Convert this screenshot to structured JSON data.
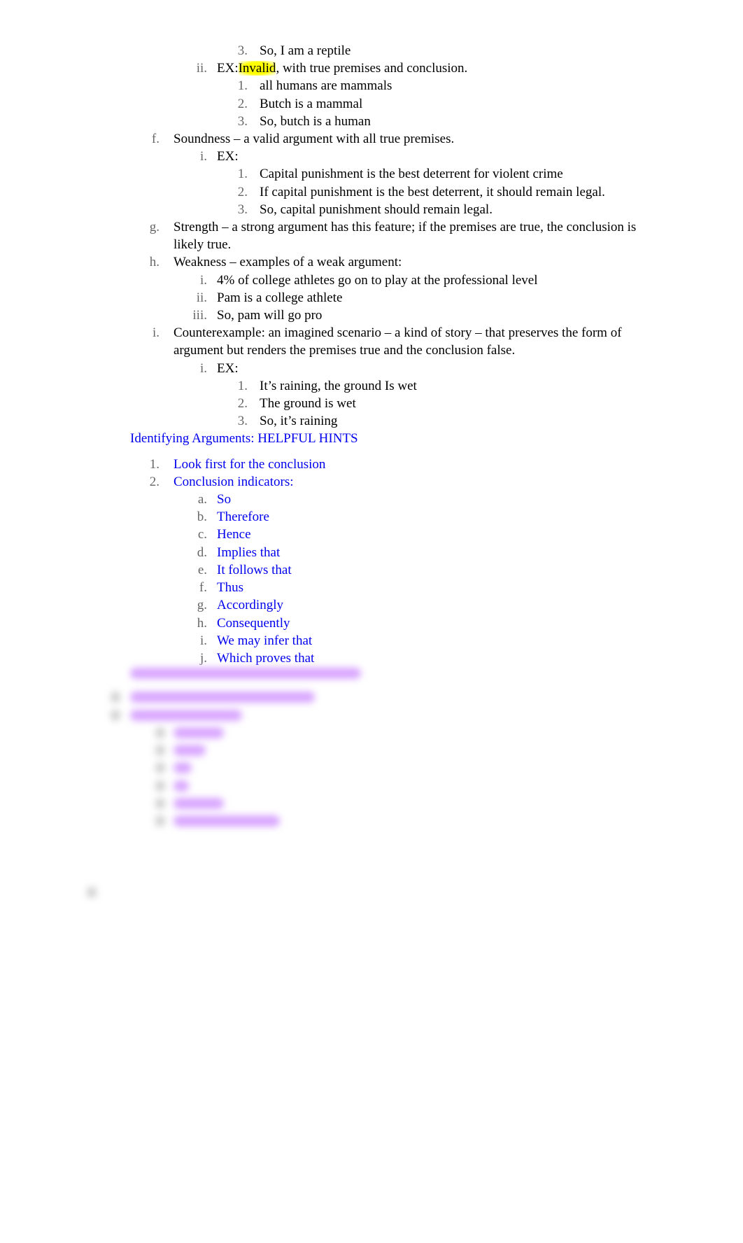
{
  "document": {
    "lines": [
      {
        "level": 4,
        "marker": "3.",
        "text": "So, I am a reptile"
      },
      {
        "level": 3,
        "marker": "ii.",
        "prefix": "EX:",
        "highlight": "Invalid",
        "text": ", with true premises and conclusion."
      },
      {
        "level": 4,
        "marker": "1.",
        "text": "all humans are mammals"
      },
      {
        "level": 4,
        "marker": "2.",
        "text": "Butch is a mammal"
      },
      {
        "level": 4,
        "marker": "3.",
        "text": "So, butch is a human"
      },
      {
        "level": 2,
        "marker": "f.",
        "text": "Soundness –  a valid argument with all true premises."
      },
      {
        "level": 3,
        "marker": "i.",
        "text": "EX:"
      },
      {
        "level": 4,
        "marker": "1.",
        "text": "Capital punishment is the best deterrent for violent crime"
      },
      {
        "level": 4,
        "marker": "2.",
        "text": "If capital punishment is the best deterrent, it should remain legal."
      },
      {
        "level": 4,
        "marker": "3.",
        "text": "So, capital punishment should remain legal."
      },
      {
        "level": 2,
        "marker": "g.",
        "text": "Strength –  a strong argument has this feature; if the premises are true, the conclusion is likely true."
      },
      {
        "level": 2,
        "marker": "h.",
        "text": "Weakness –  examples of a weak argument:"
      },
      {
        "level": 3,
        "marker": "i.",
        "text": "4% of college athletes go on to play at the professional level"
      },
      {
        "level": 3,
        "marker": "ii.",
        "text": "Pam is a college athlete"
      },
      {
        "level": 3,
        "marker": "iii.",
        "text": "So, pam will go pro"
      },
      {
        "level": 2,
        "marker": "i.",
        "text": "Counterexample:  an imagined scenario – a kind of story – that preserves the form of argument but renders the premises true and the conclusion false."
      },
      {
        "level": 3,
        "marker": "i.",
        "text": "EX:"
      },
      {
        "level": 4,
        "marker": "1.",
        "text": "It’s raining, the ground Is wet"
      },
      {
        "level": 4,
        "marker": "2.",
        "text": "The ground is wet"
      },
      {
        "level": 4,
        "marker": "3.",
        "text": "So, it’s raining"
      },
      {
        "level": 1,
        "marker": "",
        "text": "Identifying Arguments: HELPFUL HINTS",
        "color": "blue"
      },
      {
        "gap": true
      },
      {
        "level": 2,
        "marker": "1.",
        "text": "Look first for the conclusion",
        "color": "blue"
      },
      {
        "level": 2,
        "marker": "2.",
        "text": "Conclusion indicators:",
        "color": "blue"
      },
      {
        "level": 3,
        "marker": "a.",
        "text": "So",
        "color": "blue"
      },
      {
        "level": 3,
        "marker": "b.",
        "text": "Therefore",
        "color": "blue"
      },
      {
        "level": 3,
        "marker": "c.",
        "text": "Hence",
        "color": "blue"
      },
      {
        "level": 3,
        "marker": "d.",
        "text": "Implies that",
        "color": "blue"
      },
      {
        "level": 3,
        "marker": "e.",
        "text": "It follows that",
        "color": "blue"
      },
      {
        "level": 3,
        "marker": "f.",
        "text": "Thus",
        "color": "blue"
      },
      {
        "level": 3,
        "marker": "g.",
        "text": "Accordingly",
        "color": "blue"
      },
      {
        "level": 3,
        "marker": "h.",
        "text": "Consequently",
        "color": "blue"
      },
      {
        "level": 3,
        "marker": "i.",
        "text": "We may infer that",
        "color": "blue"
      },
      {
        "level": 3,
        "marker": "j.",
        "text": "Which proves that",
        "color": "blue"
      }
    ]
  },
  "colors": {
    "text": "#000000",
    "hint_text": "#0000ee",
    "highlight": "#ffff00",
    "blurred_text": "#d9a6ff"
  }
}
